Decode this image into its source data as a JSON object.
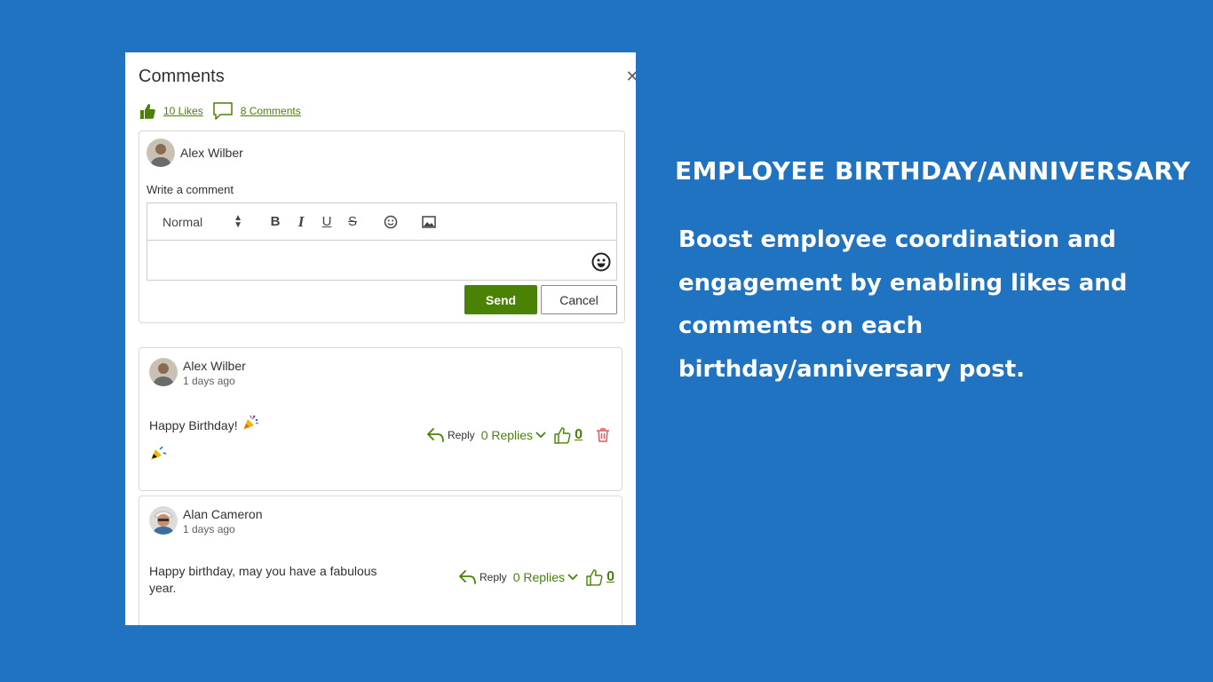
{
  "panel": {
    "title": "Comments",
    "likes_link": "10 Likes",
    "comments_link": "8 Comments"
  },
  "composer": {
    "user_name": "Alex Wilber",
    "label": "Write a comment",
    "format_value": "Normal",
    "toolbar": {
      "bold": "B",
      "italic": "I",
      "underline": "U",
      "strike": "S"
    },
    "send_label": "Send",
    "cancel_label": "Cancel"
  },
  "comments": [
    {
      "author": "Alex Wilber",
      "time": "1 days ago",
      "text": "Happy Birthday!",
      "reply_label": "Reply",
      "replies_label": "0 Replies",
      "like_count": "0",
      "deletable": true
    },
    {
      "author": "Alan Cameron",
      "time": "1 days ago",
      "text": "Happy birthday, may you have a fabulous year.",
      "reply_label": "Reply",
      "replies_label": "0 Replies",
      "like_count": "0",
      "deletable": false
    }
  ],
  "promo": {
    "title": "EMPLOYEE BIRTHDAY/ANNIVERSARY",
    "body": "Boost employee coordination and engagement by enabling likes and comments on each birthday/anniversary post."
  },
  "colors": {
    "background": "#1f73c1",
    "accent": "#498205",
    "delete": "#e15a5a"
  }
}
